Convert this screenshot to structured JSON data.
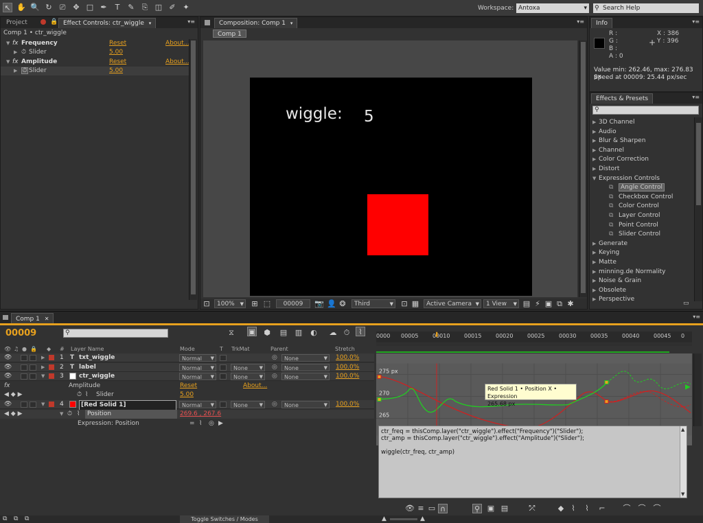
{
  "toolbar": {
    "tools": [
      "selection-tool",
      "hand-tool",
      "zoom-tool",
      "rotate-tool",
      "camera-tool",
      "pan-behind-tool",
      "rectangle-tool",
      "pen-tool",
      "type-tool",
      "brush-tool",
      "clone-stamp-tool",
      "eraser-tool",
      "roto-brush-tool",
      "puppet-tool"
    ],
    "tool_glyphs": [
      "↖",
      "✋",
      "🔍",
      "↻",
      "⎚",
      "✥",
      "□",
      "✒",
      "T",
      "✎",
      "⎘",
      "◫",
      "✐",
      "✦"
    ],
    "workspace_label": "Workspace:",
    "workspace_value": "Antoxa",
    "search_placeholder": "Search Help"
  },
  "effects_panel": {
    "tab_project": "Project",
    "tab_effect": "Effect Controls: ctr_wiggle",
    "layer_path": "Comp 1 • ctr_wiggle",
    "effects": [
      {
        "name": "Frequency",
        "reset": "Reset",
        "about": "About...",
        "param": "Slider",
        "value": "5.00"
      },
      {
        "name": "Amplitude",
        "reset": "Reset",
        "about": "About...",
        "param": "Slider",
        "value": "5.00"
      }
    ]
  },
  "composition": {
    "tab": "Composition: Comp 1",
    "crumb": "Comp 1",
    "text_label": "wiggle:",
    "text_value": "5",
    "zoom": "100%",
    "timecode": "00009",
    "resolution": "Third",
    "camera": "Active Camera",
    "views": "1 View"
  },
  "info": {
    "tab": "Info",
    "r": "R :",
    "g": "G :",
    "b": "B :",
    "a": "A : 0",
    "x": "X : 386",
    "y": "Y : 396",
    "value_line": "Value min: 262.46, max: 276.83 px",
    "speed_line": "Speed at 00009: 25.44 px/sec"
  },
  "presets": {
    "tab": "Effects & Presets",
    "items": [
      {
        "label": "3D Channel",
        "type": "cat"
      },
      {
        "label": "Audio",
        "type": "cat"
      },
      {
        "label": "Blur & Sharpen",
        "type": "cat"
      },
      {
        "label": "Channel",
        "type": "cat"
      },
      {
        "label": "Color Correction",
        "type": "cat"
      },
      {
        "label": "Distort",
        "type": "cat"
      },
      {
        "label": "Expression Controls",
        "type": "open"
      },
      {
        "label": "Angle Control",
        "type": "child",
        "selected": true
      },
      {
        "label": "Checkbox Control",
        "type": "child"
      },
      {
        "label": "Color Control",
        "type": "child"
      },
      {
        "label": "Layer Control",
        "type": "child"
      },
      {
        "label": "Point Control",
        "type": "child"
      },
      {
        "label": "Slider Control",
        "type": "child"
      },
      {
        "label": "Generate",
        "type": "cat"
      },
      {
        "label": "Keying",
        "type": "cat"
      },
      {
        "label": "Matte",
        "type": "cat"
      },
      {
        "label": "minning.de Normality",
        "type": "cat"
      },
      {
        "label": "Noise & Grain",
        "type": "cat"
      },
      {
        "label": "Obsolete",
        "type": "cat"
      },
      {
        "label": "Perspective",
        "type": "cat"
      }
    ]
  },
  "timeline": {
    "tab": "Comp 1",
    "timecode": "00009",
    "headers": {
      "layer_name": "Layer Name",
      "mode": "Mode",
      "t": "T",
      "trkmat": "TrkMat",
      "parent": "Parent",
      "stretch": "Stretch",
      "num": "#"
    },
    "layers": [
      {
        "num": "1",
        "name": "txt_wiggle",
        "mode": "Normal",
        "trkmat": "",
        "parent": "None",
        "stretch": "100.0%",
        "color": "#c0392b",
        "kind": "T"
      },
      {
        "num": "2",
        "name": "label",
        "mode": "Normal",
        "trkmat": "None",
        "parent": "None",
        "stretch": "100.0%",
        "color": "#c0392b",
        "kind": "T"
      },
      {
        "num": "3",
        "name": "ctr_wiggle",
        "mode": "Normal",
        "trkmat": "None",
        "parent": "None",
        "stretch": "100.0%",
        "color": "#c0392b",
        "kind": "solid"
      },
      {
        "num": "4",
        "name": "[Red Solid 1]",
        "mode": "Normal",
        "trkmat": "None",
        "parent": "None",
        "stretch": "100.0%",
        "color": "#c0392b",
        "kind": "solid-red"
      }
    ],
    "sub": {
      "amplitude": "Amplitude",
      "amplitude_reset": "Reset",
      "amplitude_about": "About...",
      "slider": "Slider",
      "slider_value": "5.00",
      "position": "Position",
      "position_value": "269.6 , 267.6",
      "expression": "Expression: Position"
    },
    "ruler": [
      "0000",
      "00005",
      "00010",
      "00015",
      "00020",
      "00025",
      "00030",
      "00035",
      "00040",
      "00045",
      "0"
    ],
    "graph_labels": [
      "275 px",
      "270",
      "265"
    ],
    "tooltip_line1": "Red Solid 1 • Position X • Expression",
    "tooltip_line2": "265.68 px",
    "expression_lines": [
      "ctr_freq = thisComp.layer(\"ctr_wiggle\").effect(\"Frequency\")(\"Slider\");",
      "ctr_amp = thisComp.layer(\"ctr_wiggle\").effect(\"Amplitude\")(\"Slider\");",
      "",
      "wiggle(ctr_freq, ctr_amp)"
    ],
    "toggle_label": "Toggle Switches / Modes"
  },
  "colors": {
    "accent": "#e8a11e",
    "red": "#ff0000",
    "graph_green": "#22cc22",
    "graph_red": "#cc2222"
  }
}
